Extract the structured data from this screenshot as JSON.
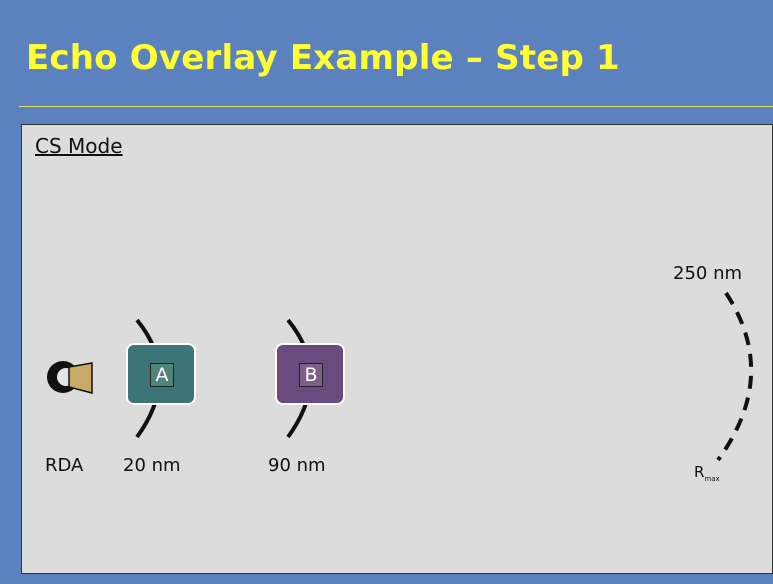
{
  "slide": {
    "title": "Echo Overlay Example – Step 1"
  },
  "panel": {
    "mode_label": "CS Mode",
    "radar_label": "RDA",
    "targets": [
      {
        "id": "A",
        "range_label": "20 nm",
        "color": "#3d7478"
      },
      {
        "id": "B",
        "range_label": "90 nm",
        "color": "#6b4a80"
      }
    ],
    "max_range": {
      "range_label": "250 nm",
      "label_main": "R",
      "label_sub": "max"
    }
  },
  "colors": {
    "background": "#5b82bf",
    "title": "#ffff33",
    "panel": "#dcdcdc"
  }
}
